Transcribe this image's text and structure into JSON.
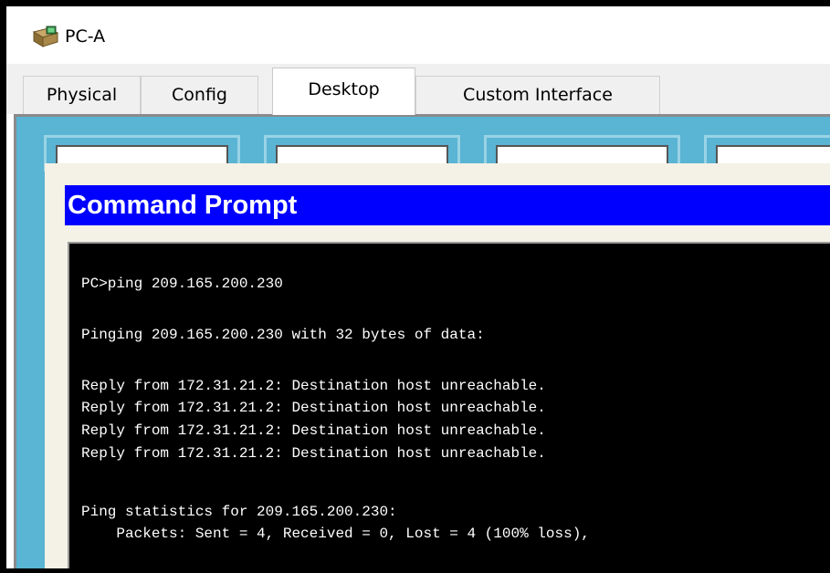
{
  "window": {
    "title": "PC-A"
  },
  "tabs": [
    {
      "label": "Physical",
      "active": false
    },
    {
      "label": "Config",
      "active": false
    },
    {
      "label": "Desktop",
      "active": true
    },
    {
      "label": "Custom Interface",
      "active": false
    }
  ],
  "command_prompt": {
    "title": "Command Prompt",
    "lines": [
      "PC>ping 209.165.200.230",
      "Pinging 209.165.200.230 with 32 bytes of data:",
      "Reply from 172.31.21.2: Destination host unreachable.",
      "Reply from 172.31.21.2: Destination host unreachable.",
      "Reply from 172.31.21.2: Destination host unreachable.",
      "Reply from 172.31.21.2: Destination host unreachable.",
      "Ping statistics for 209.165.200.230:",
      "    Packets: Sent = 4, Received = 0, Lost = 4 (100% loss),"
    ]
  },
  "colors": {
    "desktop_background": "#5ab4d3",
    "command_title_bar": "#0000ff",
    "terminal_background": "#000000",
    "terminal_text": "#ffffff"
  },
  "icons": {
    "app": "pc-computer-icon"
  }
}
